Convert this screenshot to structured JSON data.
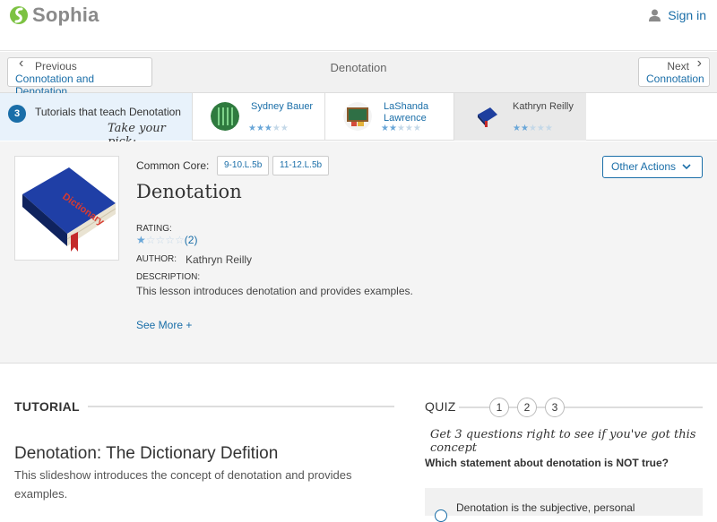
{
  "brand": {
    "name": "Sophia"
  },
  "header": {
    "signin_label": "Sign in"
  },
  "nav": {
    "prev_small": "Previous",
    "prev_link": "Connotation and Denotation",
    "title": "Denotation",
    "next_small": "Next",
    "next_link": "Connotation"
  },
  "tutorials": {
    "count": "3",
    "label": "Tutorials that teach Denotation",
    "pick": "Take your pick:",
    "items": [
      {
        "name": "Sydney Bauer",
        "rating": 3.5
      },
      {
        "name": "LaShanda Lawrence",
        "rating": 2.5
      },
      {
        "name": "Kathryn Reilly",
        "rating": 1.5
      }
    ]
  },
  "lesson": {
    "common_core_label": "Common Core:",
    "tags": [
      "9-10.L.5b",
      "11-12.L.5b"
    ],
    "actions_label": "Other Actions",
    "title": "Denotation",
    "rating_label": "RATING:",
    "rating": 1,
    "rating_count": "(2)",
    "author_label": "AUTHOR:",
    "author": "Kathryn Reilly",
    "description_label": "DESCRIPTION:",
    "description": "This lesson introduces denotation and provides examples.",
    "see_more": "See More +",
    "cover_text": "Dictionary"
  },
  "tutorial_section": {
    "heading": "TUTORIAL",
    "title": "Denotation: The Dictionary Defition",
    "description": "This slideshow introduces the concept of denotation and provides examples."
  },
  "quiz": {
    "heading": "QUIZ",
    "numbers": [
      "1",
      "2",
      "3"
    ],
    "note": "Get 3 questions right to see if you've got this concept",
    "question": "Which statement about denotation is NOT true?",
    "first_answer": "Denotation is the subjective, personal"
  },
  "colors": {
    "accent": "#1a6ea8",
    "logo_green": "#7cc242",
    "panel_bg": "#f4f4f4"
  }
}
